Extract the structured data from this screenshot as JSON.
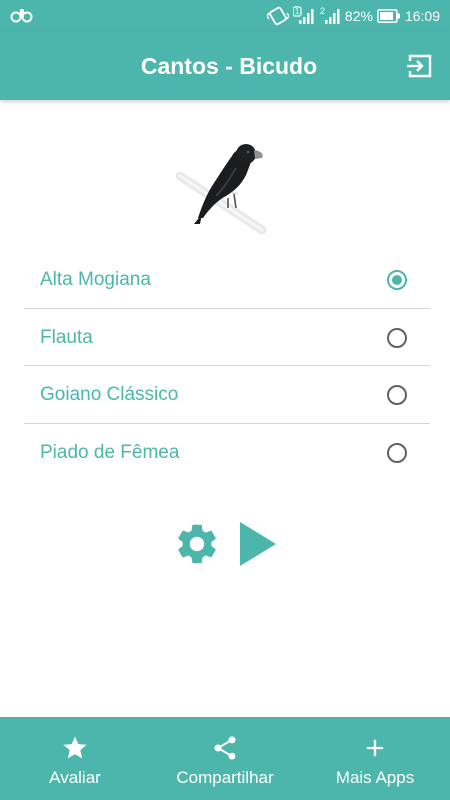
{
  "status_bar": {
    "battery_percent": "82%",
    "time": "16:09",
    "sim1": "1",
    "sim2": "2"
  },
  "app_bar": {
    "title": "Cantos - Bicudo",
    "exit_icon": "exit-icon"
  },
  "colors": {
    "primary": "#4db6ac",
    "divider": "#d6d6d6",
    "radio_unselected": "#616161"
  },
  "options": [
    {
      "label": "Alta Mogiana",
      "selected": true
    },
    {
      "label": "Flauta",
      "selected": false
    },
    {
      "label": "Goiano Clássico",
      "selected": false
    },
    {
      "label": "Piado de Fêmea",
      "selected": false
    }
  ],
  "controls": {
    "settings_icon": "gear-icon",
    "play_icon": "play-icon"
  },
  "bottom_nav": [
    {
      "label": "Avaliar",
      "icon": "star-icon"
    },
    {
      "label": "Compartilhar",
      "icon": "share-icon"
    },
    {
      "label": "Mais Apps",
      "icon": "plus-icon"
    }
  ]
}
